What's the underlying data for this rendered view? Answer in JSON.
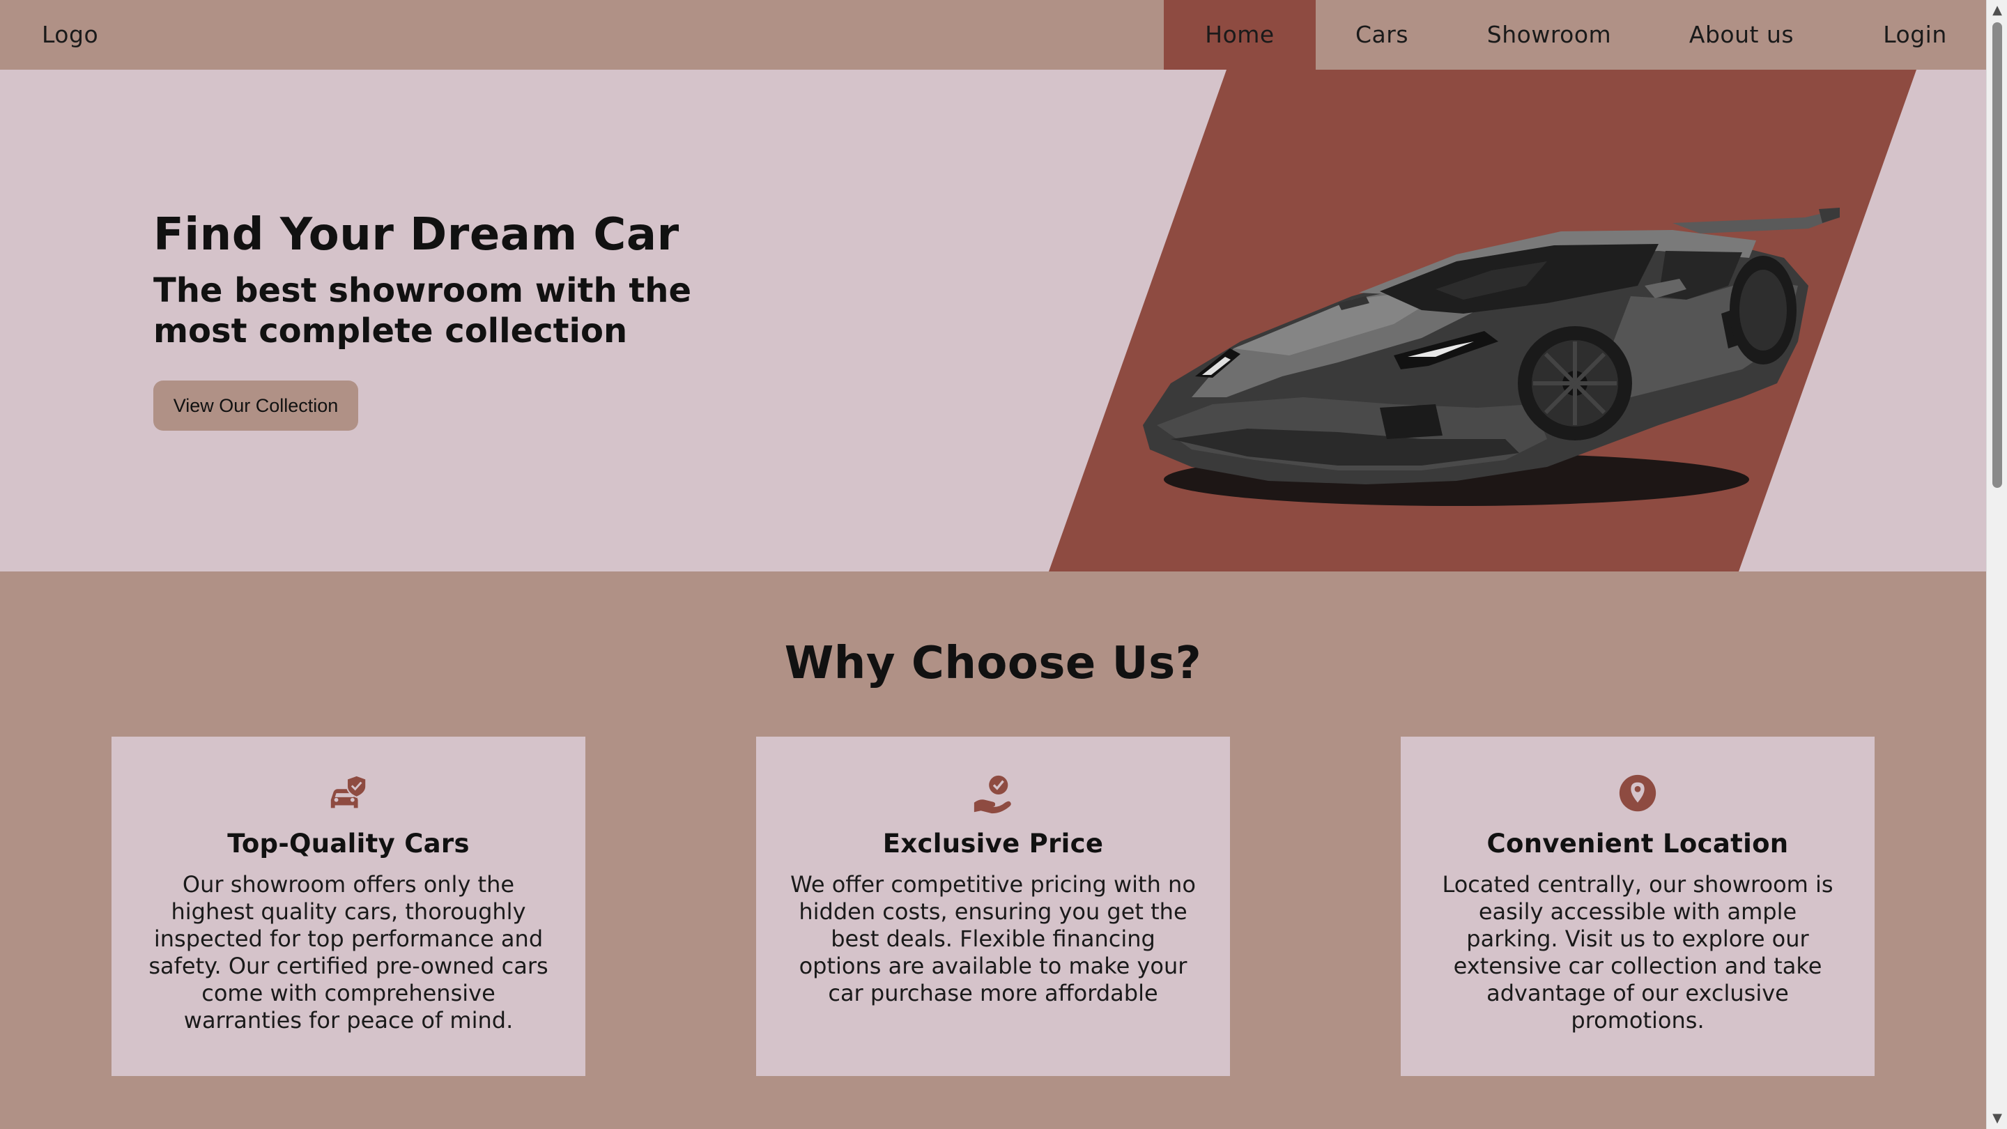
{
  "navbar": {
    "logo": "Logo",
    "links": [
      {
        "label": "Home",
        "active": true
      },
      {
        "label": "Cars",
        "active": false
      },
      {
        "label": "Showroom",
        "active": false
      },
      {
        "label": "About us",
        "active": false
      },
      {
        "label": "Login",
        "active": false
      }
    ]
  },
  "hero": {
    "title": "Find Your Dream Car",
    "subtitle": "The best showroom with the most complete collection",
    "cta_label": "View Our Collection",
    "image": "sports-car-illustration"
  },
  "why": {
    "title": "Why Choose Us?",
    "cards": [
      {
        "icon": "car-shield-icon",
        "title": "Top-Quality Cars",
        "text": "Our showroom offers only the highest quality cars, thoroughly inspected for top performance and safety. Our certified pre-owned cars come with comprehensive warranties for peace of mind."
      },
      {
        "icon": "hand-check-icon",
        "title": "Exclusive Price",
        "text": "We offer competitive pricing with no hidden costs, ensuring you get the best deals. Flexible financing options are available to make your car purchase more affordable"
      },
      {
        "icon": "location-pin-icon",
        "title": "Convenient Location",
        "text": "Located centrally, our showroom is easily accessible with ample parking. Visit us to explore our extensive car collection and take advantage of our exclusive promotions."
      }
    ]
  },
  "colors": {
    "nav_bg": "#b09186",
    "accent": "#8e4b41",
    "hero_bg": "#d5c3ca",
    "card_bg": "#d5c3ca",
    "section_bg": "#b09186"
  },
  "scrollbar": {
    "up_icon": "scroll-up-arrow-icon",
    "down_icon": "scroll-down-arrow-icon"
  }
}
